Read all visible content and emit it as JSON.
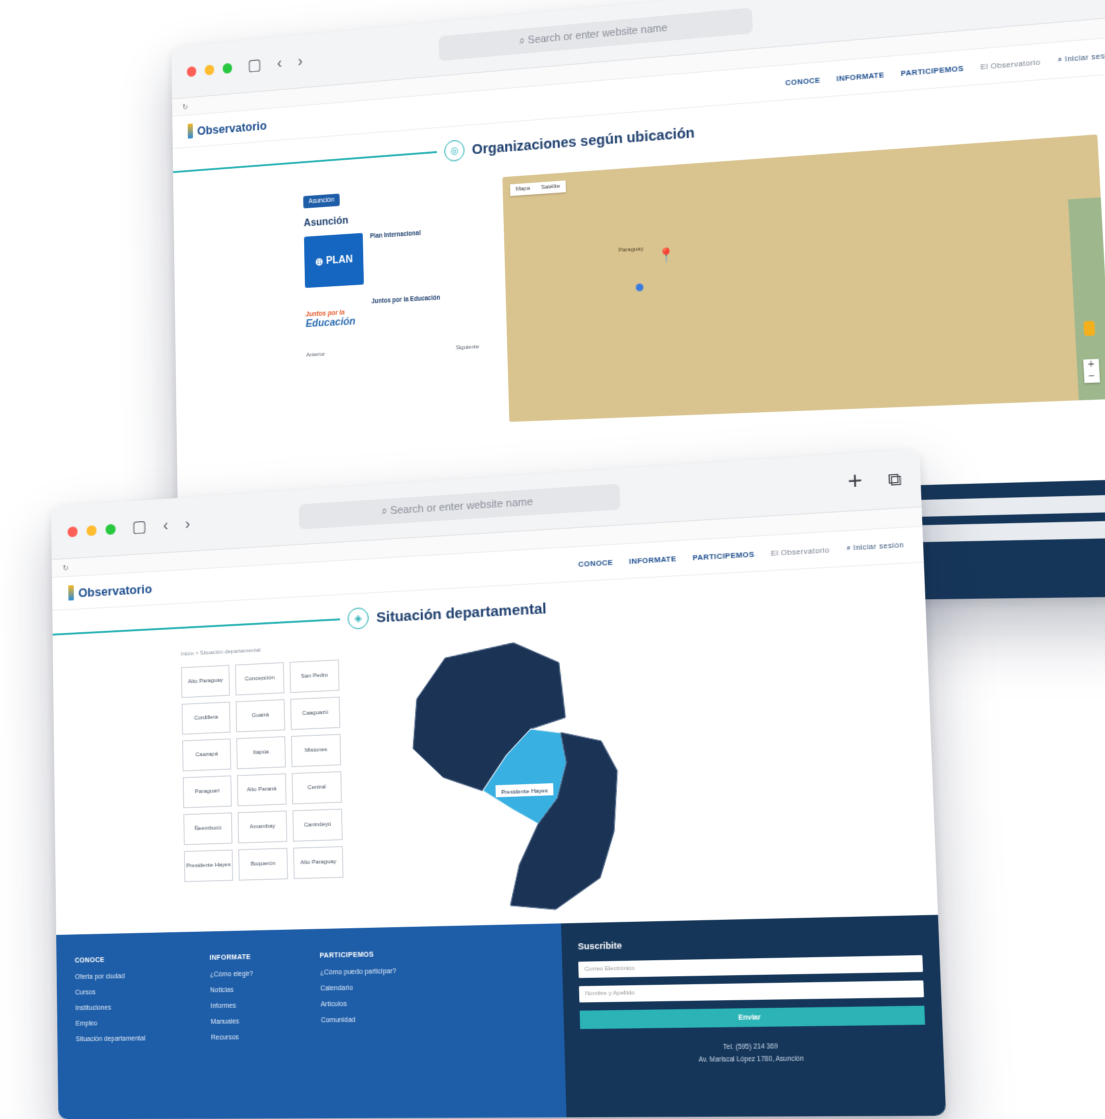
{
  "browser": {
    "search_placeholder": "Search or enter website name"
  },
  "site": {
    "logo_text": "Observatorio",
    "nav": [
      "CONOCE",
      "INFORMATE",
      "PARTICIPEMOS",
      "El Observatorio"
    ],
    "login": "Iniciar sesión"
  },
  "window1": {
    "section_title": "Organizaciones según ubicación",
    "chip": "Asunción",
    "city": "Asunción",
    "org1": {
      "logo": "PLAN",
      "name": "Plan Internacional"
    },
    "org2": {
      "logo_top": "Juntos por la",
      "logo_main": "Educación",
      "name": "Juntos por la Educación"
    },
    "pagination": {
      "prev": "Anterior",
      "next": "Siguiente"
    },
    "map_tabs": [
      "Mapa",
      "Satélite"
    ],
    "map_labels": [
      "Paraguay"
    ]
  },
  "window2": {
    "section_title": "Situación departamental",
    "breadcrumb": "Inicio > Situación departamental",
    "departments": [
      "Alto Paraguay",
      "Concepción",
      "San Pedro",
      "Cordillera",
      "Guairá",
      "Caaguazú",
      "Caazapá",
      "Itapúa",
      "Misiones",
      "Paraguarí",
      "Alto Paraná",
      "Central",
      "Ñeembucú",
      "Amambay",
      "Canindeyú",
      "Presidente Hayes",
      "Boquerón",
      "Alto Paraguay"
    ],
    "highlight_label": "Presidente Hayes",
    "footer": {
      "col1_title": "CONOCE",
      "col1": [
        "Oferta por ciudad",
        "Cursos",
        "Instituciones",
        "Empleo",
        "Situación departamental"
      ],
      "col2_title": "INFORMATE",
      "col2": [
        "¿Cómo elegir?",
        "Noticias",
        "Informes",
        "Manuales",
        "Recursos"
      ],
      "col3_title": "PARTICIPEMOS",
      "col3": [
        "¿Cómo puedo participar?",
        "Calendario",
        "Artículos",
        "Comunidad"
      ],
      "subscribe_title": "Suscribite",
      "email_placeholder": "Correo Electrónico",
      "name_placeholder": "Nombre y Apellido",
      "send_label": "Enviar",
      "phone": "Tel. (595) 214 369",
      "address": "Av. Mariscal López 1780, Asunción"
    }
  }
}
